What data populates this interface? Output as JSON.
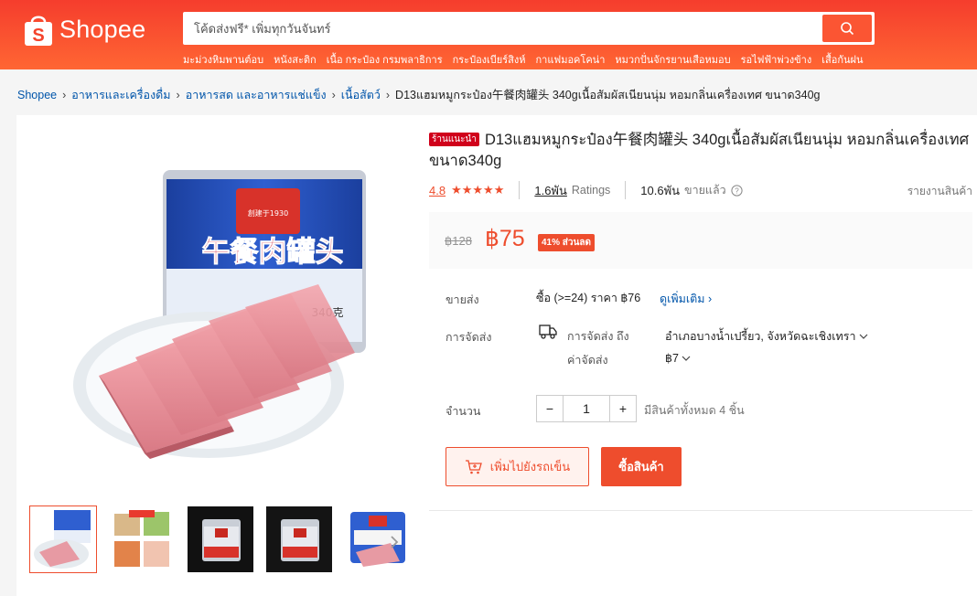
{
  "header": {
    "brand": "Shopee",
    "search_placeholder": "โค้ดส่งฟรี* เพิ่มทุกวันจันทร์",
    "suggestions": [
      "มะม่วงหิมพานต์อบ",
      "หนังสะติก",
      "เนื้อ กระป๋อง กรมพลาธิการ",
      "กระป๋องเบียร์สิงห์",
      "กาแฟมอคโคน่า",
      "หมวกปั่นจักรยานเสือหมอบ",
      "รอไฟฟ้าพ่วงข้าง",
      "เสื้อกันฝน"
    ]
  },
  "breadcrumb": [
    "Shopee",
    "อาหารและเครื่องดื่ม",
    "อาหารสด และอาหารแช่แข็ง",
    "เนื้อสัตว์",
    "D13แฮมหมูกระป๋อง午餐肉罐头 340gเนื้อสัมผัสเนียนนุ่ม หอมกลิ่นเครื่องเทศ ขนาด340g"
  ],
  "product": {
    "badge": "ร้านแนะนำ",
    "title": "D13แฮมหมูกระป๋อง午餐肉罐头 340gเนื้อสัมผัสเนียนนุ่ม หอมกลิ่นเครื่องเทศ ขนาด340g",
    "rating": "4.8",
    "stars": "★★★★★",
    "ratings_count": "1.6พัน",
    "ratings_label": "Ratings",
    "sold_count": "10.6พัน",
    "sold_label": "ขายแล้ว",
    "report": "รายงานสินค้า",
    "original_price": "฿128",
    "price": "฿75",
    "discount": "41% ส่วนลด",
    "image_text": "午餐肉罐头",
    "can_weight": "340克",
    "brand_year": "創建于1930"
  },
  "wholesale": {
    "label": "ขายส่ง",
    "text": "ซื้อ (>=24) ราคา ฿76",
    "more": "ดูเพิ่มเติม"
  },
  "shipping": {
    "label": "การจัดส่ง",
    "to_label": "การจัดส่ง ถึง",
    "destination": "อำเภอบางน้ำเปรี้ยว, จังหวัดฉะเชิงเทรา",
    "fee_label": "ค่าจัดส่ง",
    "fee": "฿7"
  },
  "quantity": {
    "label": "จำนวน",
    "value": "1",
    "stock": "มีสินค้าทั้งหมด 4 ชิ้น"
  },
  "actions": {
    "add_to_cart": "เพิ่มไปยังรถเข็น",
    "buy_now": "ซื้อสินค้า"
  },
  "colors": {
    "brand": "#ee4d2d",
    "link": "#0055aa"
  }
}
